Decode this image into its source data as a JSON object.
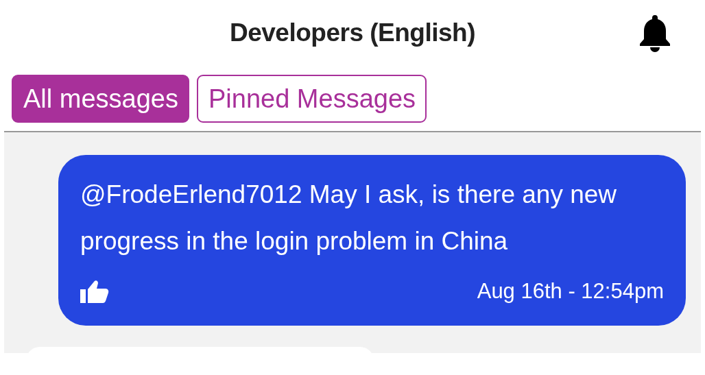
{
  "header": {
    "title": "Developers (English)"
  },
  "tabs": [
    {
      "label": "All messages",
      "selected": true
    },
    {
      "label": "Pinned Messages",
      "selected": false
    }
  ],
  "messages": [
    {
      "text": "@FrodeErlend7012 May I ask, is there any new progress in the login problem in China",
      "time": "Aug 16th - 12:54pm",
      "own": true
    }
  ]
}
